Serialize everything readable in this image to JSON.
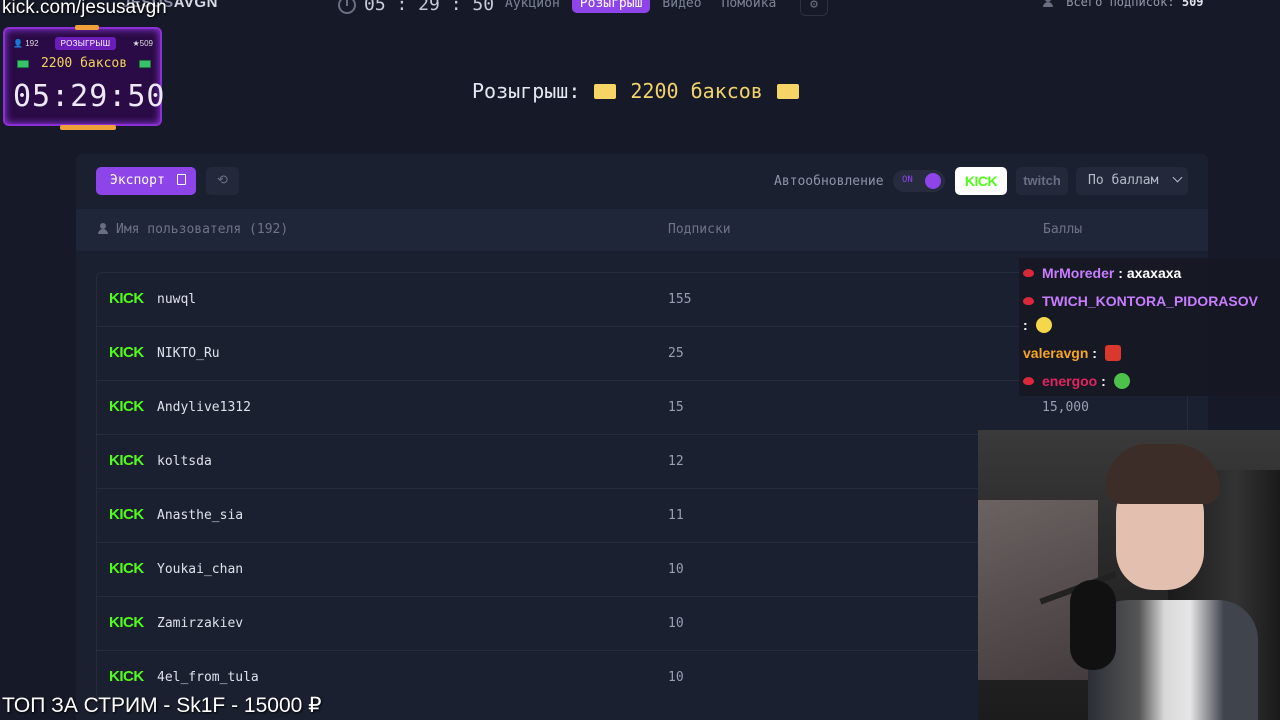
{
  "nav": {
    "brand_dim": "JESUS",
    "brand": "AVGN",
    "timer": "05 : 29 : 50",
    "tabs": [
      {
        "label": "Аукцион",
        "active": false
      },
      {
        "label": "Розыгрыш",
        "active": true
      },
      {
        "label": "Видео",
        "active": false
      },
      {
        "label": "Помойка",
        "active": false
      }
    ],
    "total_subs_label": "Всего подписок:",
    "total_subs_value": "509"
  },
  "overlay": {
    "url": "kick.com/jesusavgn",
    "count_left": "192",
    "badge": "РОЗЫГРЫШ",
    "count_right": "509",
    "prize": "2200 баксов",
    "timer": "05:29:50"
  },
  "headline": {
    "label": "Розыгрыш:",
    "prize": "2200 баксов"
  },
  "toolbar": {
    "export_label": "Экспорт",
    "auto_update_label": "Автообновление",
    "toggle_state": "ON",
    "kick_label": "KICK",
    "twitch_label": "twitch",
    "sort_label": "По баллам"
  },
  "table": {
    "col_user": "Имя пользователя (192)",
    "col_subs": "Подписки",
    "col_points": "Баллы",
    "platform_logo": "KICK",
    "rows": [
      {
        "name": "nuwql",
        "subs": "155",
        "points": ""
      },
      {
        "name": "NIKTO_Ru",
        "subs": "25",
        "points": ""
      },
      {
        "name": "Andylive1312",
        "subs": "15",
        "points": "15,000"
      },
      {
        "name": "koltsda",
        "subs": "12",
        "points": ""
      },
      {
        "name": "Anasthe_sia",
        "subs": "11",
        "points": ""
      },
      {
        "name": "Youkai_chan",
        "subs": "10",
        "points": ""
      },
      {
        "name": "Zamirzakiev",
        "subs": "10",
        "points": ""
      },
      {
        "name": "4el_from_tula",
        "subs": "10",
        "points": ""
      }
    ]
  },
  "chat": [
    {
      "user": "MrMoreder",
      "user_color": "#c77dff",
      "message": "ахахаха",
      "emote": ""
    },
    {
      "user": "TWICH_KONTORA_PIDORASOV",
      "user_color": "#c77dff",
      "message": "",
      "emote": "thinking-emote"
    },
    {
      "user": "valeravgn",
      "user_color": "#f5a623",
      "message": "",
      "emote": "red-face-emote"
    },
    {
      "user": "energoo",
      "user_color": "#e0245e",
      "message": "",
      "emote": "green-frog-emote"
    }
  ],
  "bottom_ticker": "ТОП ЗА СТРИМ - Sk1F - 15000 ₽",
  "colors": {
    "accent": "#8d45ea",
    "kick_green": "#53fc18",
    "prize_gold": "#f2d26b",
    "background": "#161a28"
  }
}
